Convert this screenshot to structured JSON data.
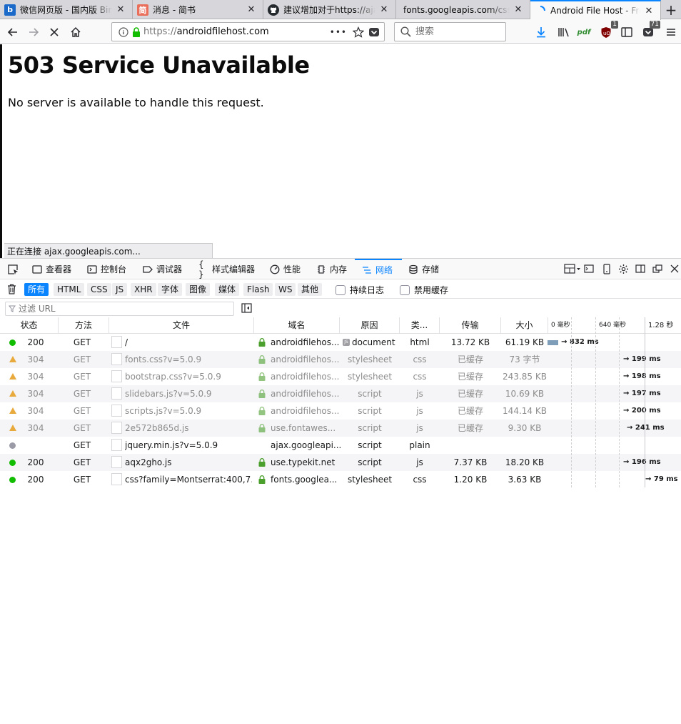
{
  "browser": {
    "tabs": [
      {
        "title": "微信网页版 - 国内版 Bing",
        "favicon": "bing-icon",
        "color": "#1b6ac9",
        "glyph": "b"
      },
      {
        "title": "消息 - 简书",
        "favicon": "jianshu-icon",
        "color": "#ea6f5a",
        "glyph": "简"
      },
      {
        "title": "建议增加对于https://ajax",
        "favicon": "github-icon",
        "color": "#24292e",
        "glyph": ""
      },
      {
        "title": "fonts.googleapis.com/css?",
        "favicon": "",
        "color": "",
        "glyph": ""
      },
      {
        "title": "Android File Host - Free",
        "favicon": "loading-icon",
        "color": "#0a84ff",
        "glyph": ""
      }
    ],
    "new_tab_label": "+",
    "url_scheme": "https://",
    "url_host": "androidfilehost.com",
    "page_actions_label": "•••",
    "search_placeholder": "搜索",
    "badges": {
      "ublock": "1",
      "pocket": "71"
    },
    "accent": "#0a84ff"
  },
  "page": {
    "heading": "503 Service Unavailable",
    "message": "No server is available to handle this request.",
    "status_text": "正在连接 ajax.googleapis.com..."
  },
  "devtools": {
    "tabs": [
      {
        "label": "查看器",
        "icon": "inspector-icon"
      },
      {
        "label": "控制台",
        "icon": "console-icon"
      },
      {
        "label": "调试器",
        "icon": "debugger-icon"
      },
      {
        "label": "样式编辑器",
        "icon": "style-editor-icon"
      },
      {
        "label": "性能",
        "icon": "performance-icon"
      },
      {
        "label": "内存",
        "icon": "memory-icon"
      },
      {
        "label": "网络",
        "icon": "network-icon"
      },
      {
        "label": "存储",
        "icon": "storage-icon"
      }
    ],
    "filter_types": [
      "所有",
      "HTML",
      "CSS",
      "JS",
      "XHR",
      "字体",
      "图像",
      "媒体",
      "Flash",
      "WS",
      "其他"
    ],
    "persist_logs": "持续日志",
    "disable_cache": "禁用缓存",
    "url_filter_placeholder": "过滤 URL",
    "columns": [
      "状态",
      "方法",
      "文件",
      "域名",
      "原因",
      "类...",
      "传输",
      "大小"
    ],
    "timeline_ticks": [
      "0 毫秒",
      "640 毫秒",
      "1.28 秒"
    ],
    "requests": [
      {
        "status": "200",
        "status_kind": "ok",
        "method": "GET",
        "file": "/",
        "domain": "androidfilehos...",
        "secure": true,
        "cause": "document",
        "cause_badge": "JS",
        "type": "html",
        "transferred": "13.72 KB",
        "size": "61.19 KB",
        "time": "→ 832 ms",
        "start_ms": 0,
        "duration_ms": 40
      },
      {
        "status": "304",
        "status_kind": "cached",
        "method": "GET",
        "file": "fonts.css?v=5.0.9",
        "domain": "androidfilehos...",
        "secure": true,
        "cause": "stylesheet",
        "type": "css",
        "transferred": "已缓存",
        "size": "73 字节",
        "time": "→ 199 ms",
        "start_ms": 0,
        "duration_ms": 0
      },
      {
        "status": "304",
        "status_kind": "cached",
        "method": "GET",
        "file": "bootstrap.css?v=5.0.9",
        "domain": "androidfilehos...",
        "secure": true,
        "cause": "stylesheet",
        "type": "css",
        "transferred": "已缓存",
        "size": "243.85 KB",
        "time": "→ 198 ms",
        "start_ms": 0,
        "duration_ms": 0
      },
      {
        "status": "304",
        "status_kind": "cached",
        "method": "GET",
        "file": "slidebars.js?v=5.0.9",
        "domain": "androidfilehos...",
        "secure": true,
        "cause": "script",
        "type": "js",
        "transferred": "已缓存",
        "size": "10.69 KB",
        "time": "→ 197 ms",
        "start_ms": 0,
        "duration_ms": 0
      },
      {
        "status": "304",
        "status_kind": "cached",
        "method": "GET",
        "file": "scripts.js?v=5.0.9",
        "domain": "androidfilehos...",
        "secure": true,
        "cause": "script",
        "type": "js",
        "transferred": "已缓存",
        "size": "144.14 KB",
        "time": "→ 200 ms",
        "start_ms": 0,
        "duration_ms": 0
      },
      {
        "status": "304",
        "status_kind": "cached",
        "method": "GET",
        "file": "2e572b865d.js",
        "domain": "use.fontawes...",
        "secure": true,
        "cause": "script",
        "type": "js",
        "transferred": "已缓存",
        "size": "9.30 KB",
        "time": "→ 241 ms",
        "start_ms": 0,
        "duration_ms": 0
      },
      {
        "status": "",
        "status_kind": "pending",
        "method": "GET",
        "file": "jquery.min.js?v=5.0.9",
        "domain": "ajax.googleapi...",
        "secure": false,
        "cause": "script",
        "type": "plain",
        "transferred": "",
        "size": "",
        "time": "",
        "start_ms": 0,
        "duration_ms": 0
      },
      {
        "status": "200",
        "status_kind": "ok",
        "method": "GET",
        "file": "aqx2gho.js",
        "domain": "use.typekit.net",
        "secure": true,
        "cause": "script",
        "type": "js",
        "transferred": "7.37 KB",
        "size": "18.20 KB",
        "time": "→ 196 ms",
        "start_ms": 0,
        "duration_ms": 0
      },
      {
        "status": "200",
        "status_kind": "ok",
        "method": "GET",
        "file": "css?family=Montserrat:400,7...",
        "domain": "fonts.googlea...",
        "secure": true,
        "cause": "stylesheet",
        "type": "css",
        "transferred": "1.20 KB",
        "size": "3.63 KB",
        "time": "→ 79 ms",
        "start_ms": 0,
        "duration_ms": 0
      }
    ],
    "status_colors": {
      "ok": "#12bc00",
      "cached": "#e8a93d",
      "pending": "#9b9ba8"
    }
  }
}
